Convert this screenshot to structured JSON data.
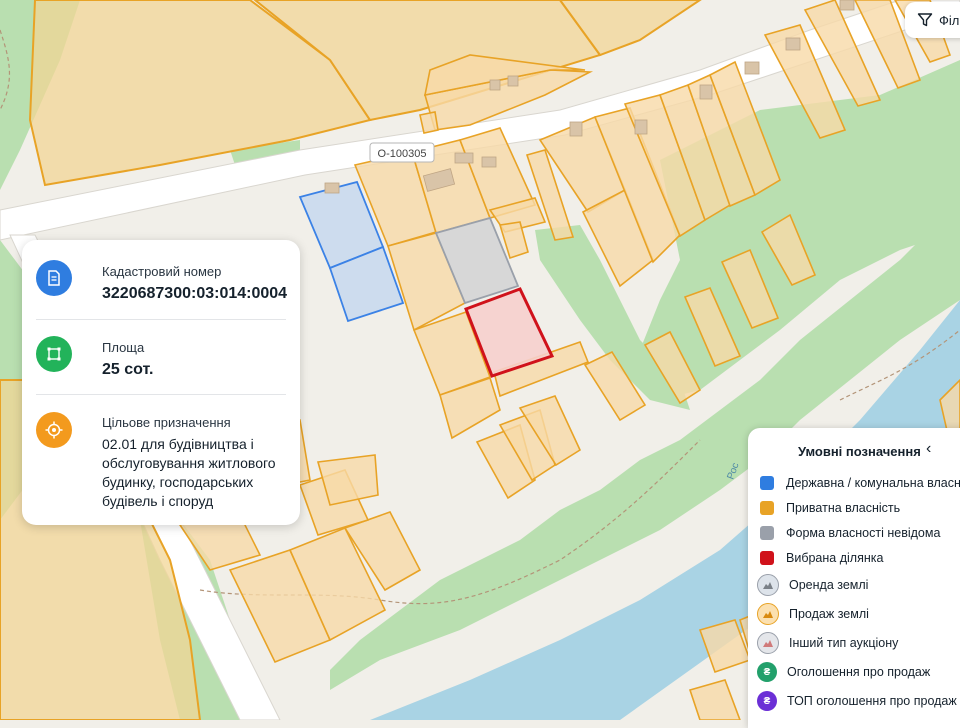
{
  "map": {
    "road_label": "О-100305",
    "river_label": "Рос",
    "selected_color": "#d0121b",
    "state_color": "#3b82e6",
    "private_color": "#e8a326",
    "unknown_color": "#9aa0aa"
  },
  "filter": {
    "label": "Філ",
    "icon": "funnel-icon"
  },
  "info": {
    "cadastral_label": "Кадастровий номер",
    "cadastral_value": "3220687300:03:014:0004",
    "area_label": "Площа",
    "area_value": "25 сот.",
    "purpose_label": "Цільове призначення",
    "purpose_value": "02.01 для будівництва і обслуговування житлового будинку, господарських будівель і споруд"
  },
  "legend": {
    "title": "Умовні позначення",
    "items": [
      {
        "label": "Державна / комунальна власність",
        "color": "#2f7de0"
      },
      {
        "label": "Приватна власність",
        "color": "#e8a326"
      },
      {
        "label": "Форма власності невідома",
        "color": "#9aa0aa"
      },
      {
        "label": "Вибрана ділянка",
        "color": "#d0121b"
      },
      {
        "label": "Оренда землі",
        "color": "#9aa0aa"
      },
      {
        "label": "Продаж землі",
        "color": "#e8a326"
      },
      {
        "label": "Інший тип аукціону",
        "color": "#9aa0aa"
      },
      {
        "label": "Оголошення про продаж",
        "color": "#22a06b"
      },
      {
        "label": "ТОП оголошення про продаж",
        "color": "#6b2fd6"
      }
    ]
  }
}
